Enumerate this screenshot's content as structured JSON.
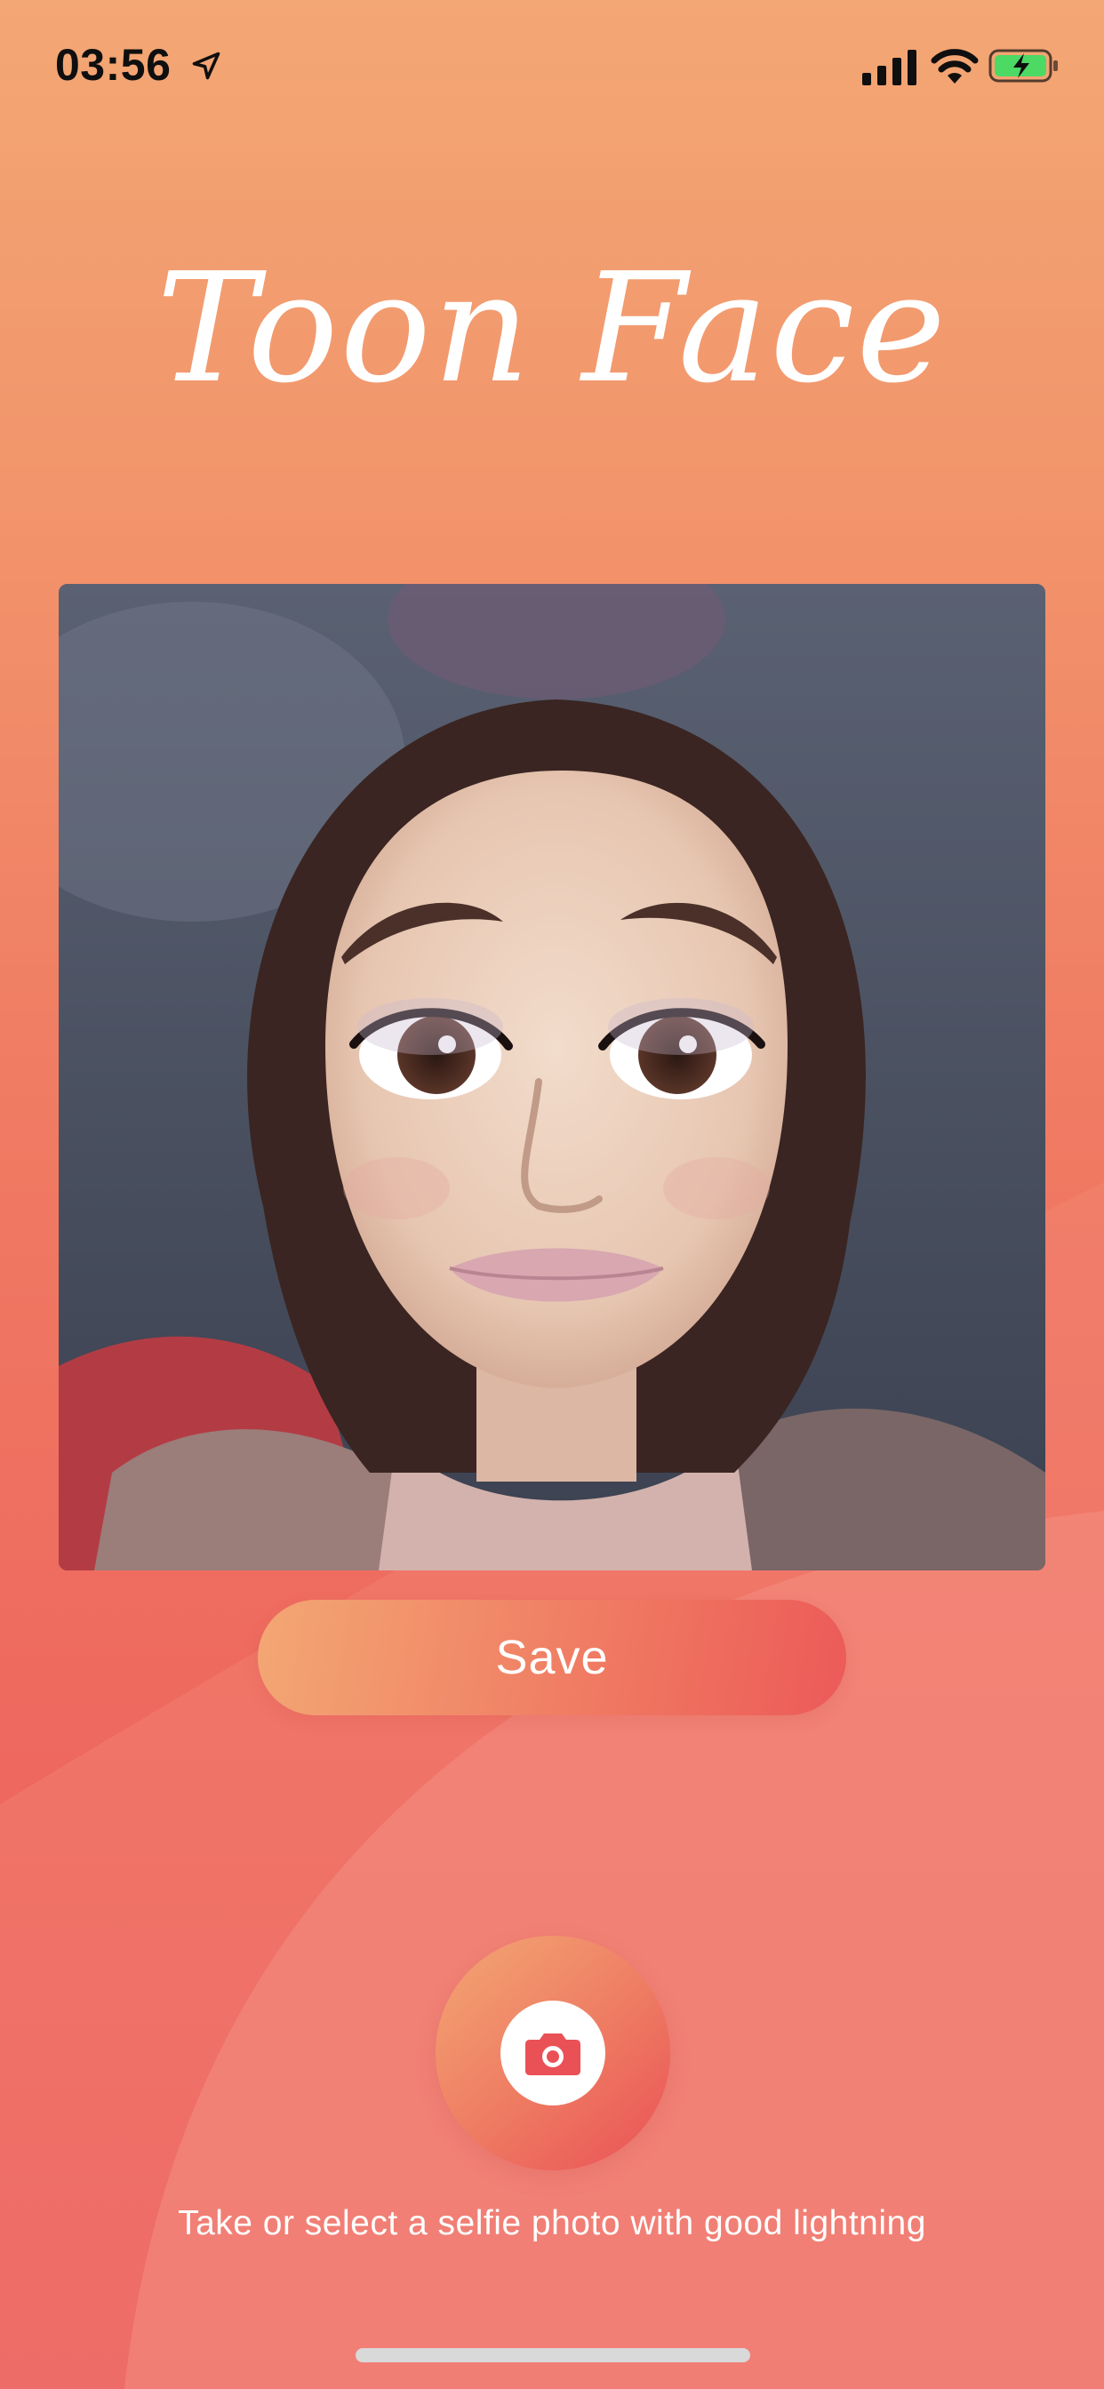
{
  "status_bar": {
    "time": "03:56",
    "icons": [
      "location-arrow-icon",
      "cellular-signal-icon",
      "wifi-icon",
      "battery-charging-icon"
    ],
    "battery_color": "#4cd964"
  },
  "app": {
    "title": "Toon Face"
  },
  "photo": {
    "description_icon": "cartoon-selfie-image"
  },
  "actions": {
    "save_label": "Save",
    "camera_icon": "camera-icon"
  },
  "hint": {
    "text": "Take or select a selfie photo with good lightning"
  },
  "colors": {
    "gradient_top": "#f3a774",
    "gradient_bottom": "#ec5d5e",
    "button_start": "#f3a774",
    "button_end": "#ec5a58",
    "camera_glyph": "#ea5156"
  }
}
